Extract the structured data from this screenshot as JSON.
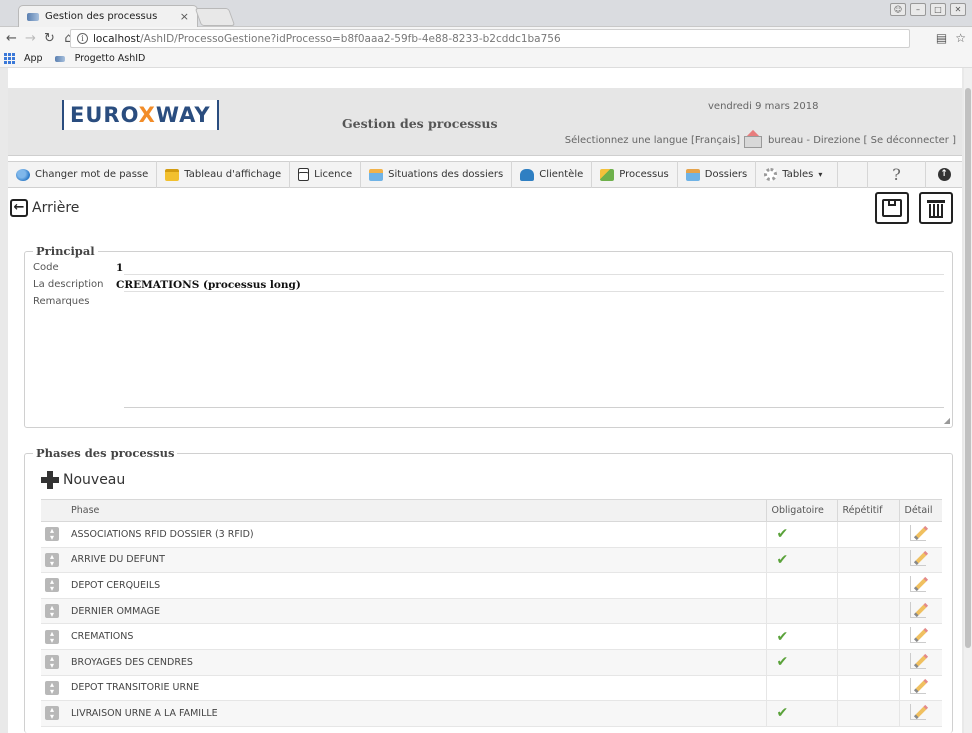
{
  "browser": {
    "tab_title": "Gestion des processus",
    "tab_close": "×",
    "url_prefix": "",
    "url_host": "localhost",
    "url_path": "/AshID/ProcessoGestione?idProcesso=b8f0aaa2-59fb-4e88-8233-b2cddc1ba756",
    "bookmarks": [
      {
        "label": "App"
      },
      {
        "label": "Progetto AshID"
      }
    ]
  },
  "header": {
    "logo_left": "EURO",
    "logo_x": "X",
    "logo_right": "WAY",
    "title": "Gestion des processus",
    "date": "vendredi 9 mars 2018",
    "language_text": "Sélectionnez une langue [Français]",
    "user_text": "bureau - Direzione [ Se déconnecter ]"
  },
  "toolbar": {
    "items": [
      {
        "label": "Changer mot de passe",
        "icon": "key-icon"
      },
      {
        "label": "Tableau d'affichage",
        "icon": "board-icon"
      },
      {
        "label": "Licence",
        "icon": "document-icon"
      },
      {
        "label": "Situations des dossiers",
        "icon": "chart-icon"
      },
      {
        "label": "Clientèle",
        "icon": "users-icon"
      },
      {
        "label": "Processus",
        "icon": "process-icon"
      },
      {
        "label": "Dossiers",
        "icon": "folder-icon"
      },
      {
        "label": "Tables",
        "icon": "gear-icon"
      }
    ],
    "help": "?",
    "caret": "▾"
  },
  "actions": {
    "back_label": "Arrière"
  },
  "principal": {
    "legend": "Principal",
    "code_label": "Code",
    "code_value": "1",
    "description_label": "La description",
    "description_value": "CREMATIONS (processus long)",
    "remarks_label": "Remarques",
    "remarks_value": ""
  },
  "phases": {
    "legend": "Phases des processus",
    "new_label": "Nouveau",
    "columns": [
      "Phase",
      "Obligatoire",
      "Répétitif",
      "Détail"
    ],
    "rows": [
      {
        "phase": "ASSOCIATIONS RFID DOSSIER (3 RFID)",
        "mandatory": true,
        "repetitive": false
      },
      {
        "phase": "ARRIVE DU DEFUNT",
        "mandatory": true,
        "repetitive": false
      },
      {
        "phase": "DEPOT CERQUEILS",
        "mandatory": false,
        "repetitive": false
      },
      {
        "phase": "DERNIER OMMAGE",
        "mandatory": false,
        "repetitive": false
      },
      {
        "phase": "CREMATIONS",
        "mandatory": true,
        "repetitive": false
      },
      {
        "phase": "BROYAGES DES CENDRES",
        "mandatory": true,
        "repetitive": false
      },
      {
        "phase": "DEPOT TRANSITORIE URNE",
        "mandatory": false,
        "repetitive": false
      },
      {
        "phase": "LIVRAISON URNE A LA FAMILLE",
        "mandatory": true,
        "repetitive": false
      }
    ]
  }
}
